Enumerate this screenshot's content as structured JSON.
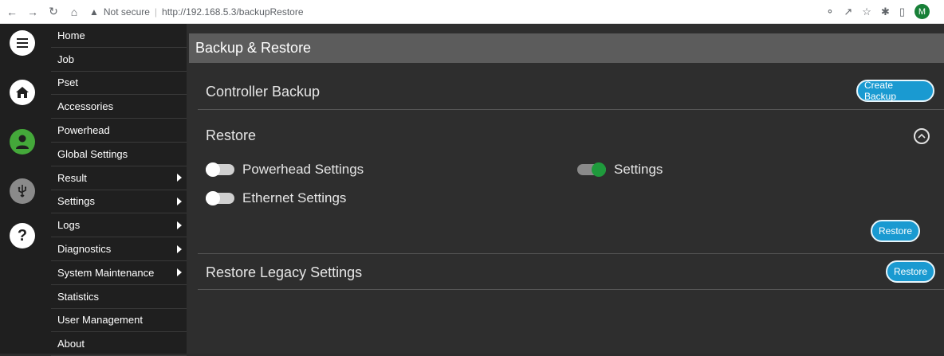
{
  "browser": {
    "security_text": "Not secure",
    "url": "http://192.168.5.3/backupRestore",
    "profile_initial": "M"
  },
  "menu": {
    "items": [
      {
        "label": "Home",
        "submenu": false
      },
      {
        "label": "Job",
        "submenu": false
      },
      {
        "label": "Pset",
        "submenu": false
      },
      {
        "label": "Accessories",
        "submenu": false
      },
      {
        "label": "Powerhead",
        "submenu": false
      },
      {
        "label": "Global Settings",
        "submenu": false
      },
      {
        "label": "Result",
        "submenu": true
      },
      {
        "label": "Settings",
        "submenu": true
      },
      {
        "label": "Logs",
        "submenu": true
      },
      {
        "label": "Diagnostics",
        "submenu": true
      },
      {
        "label": "System Maintenance",
        "submenu": true
      },
      {
        "label": "Statistics",
        "submenu": false
      },
      {
        "label": "User Management",
        "submenu": false
      },
      {
        "label": "About",
        "submenu": false
      }
    ]
  },
  "rail": {
    "icons": [
      "hamburger-icon",
      "home-icon",
      "user-icon",
      "usb-icon",
      "help-icon"
    ]
  },
  "page": {
    "title": "Backup & Restore",
    "controller_backup": {
      "title": "Controller Backup",
      "button": "Create Backup"
    },
    "restore": {
      "title": "Restore",
      "options": [
        {
          "label": "Powerhead Settings",
          "enabled": false
        },
        {
          "label": "Settings",
          "enabled": true
        },
        {
          "label": "Ethernet Settings",
          "enabled": false
        }
      ],
      "button": "Restore"
    },
    "legacy": {
      "title": "Restore Legacy Settings",
      "button": "Restore"
    }
  },
  "colors": {
    "accent": "#1a9ad1",
    "toggle_on": "#1f9a3c",
    "user_icon": "#44a83a"
  }
}
